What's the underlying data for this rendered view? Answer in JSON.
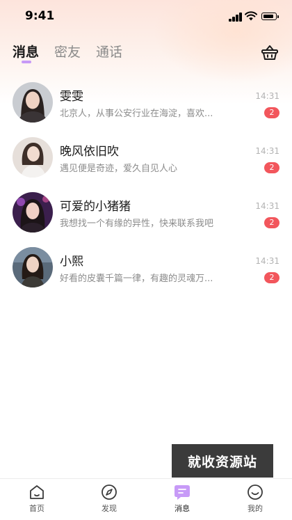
{
  "status_bar": {
    "time": "9:41"
  },
  "header": {
    "tabs": [
      {
        "label": "消息",
        "active": true
      },
      {
        "label": "密友",
        "active": false
      },
      {
        "label": "通话",
        "active": false
      }
    ],
    "basket_icon": "basket-icon"
  },
  "conversations": [
    {
      "name": "雯雯",
      "preview": "北京人，从事公安行业在海淀，喜欢...",
      "time": "14:31",
      "unread": "2"
    },
    {
      "name": "晚风依旧吹",
      "preview": "遇见便是奇迹，爱久自见人心",
      "time": "14:31",
      "unread": "2"
    },
    {
      "name": "可爱的小猪猪",
      "preview": "我想找一个有缘的异性，快来联系我吧",
      "time": "14:31",
      "unread": "2"
    },
    {
      "name": "小熙",
      "preview": "好看的皮囊千篇一律，有趣的灵魂万...",
      "time": "14:31",
      "unread": "2"
    }
  ],
  "watermark": "就收资源站",
  "tabbar": [
    {
      "label": "首页",
      "icon": "home-icon"
    },
    {
      "label": "发现",
      "icon": "compass-icon"
    },
    {
      "label": "消息",
      "icon": "message-icon",
      "active": true
    },
    {
      "label": "我的",
      "icon": "smile-icon"
    }
  ],
  "colors": {
    "accent": "#c79af7",
    "badge": "#f2565c",
    "header_gradient_top": "#fde4dc"
  }
}
